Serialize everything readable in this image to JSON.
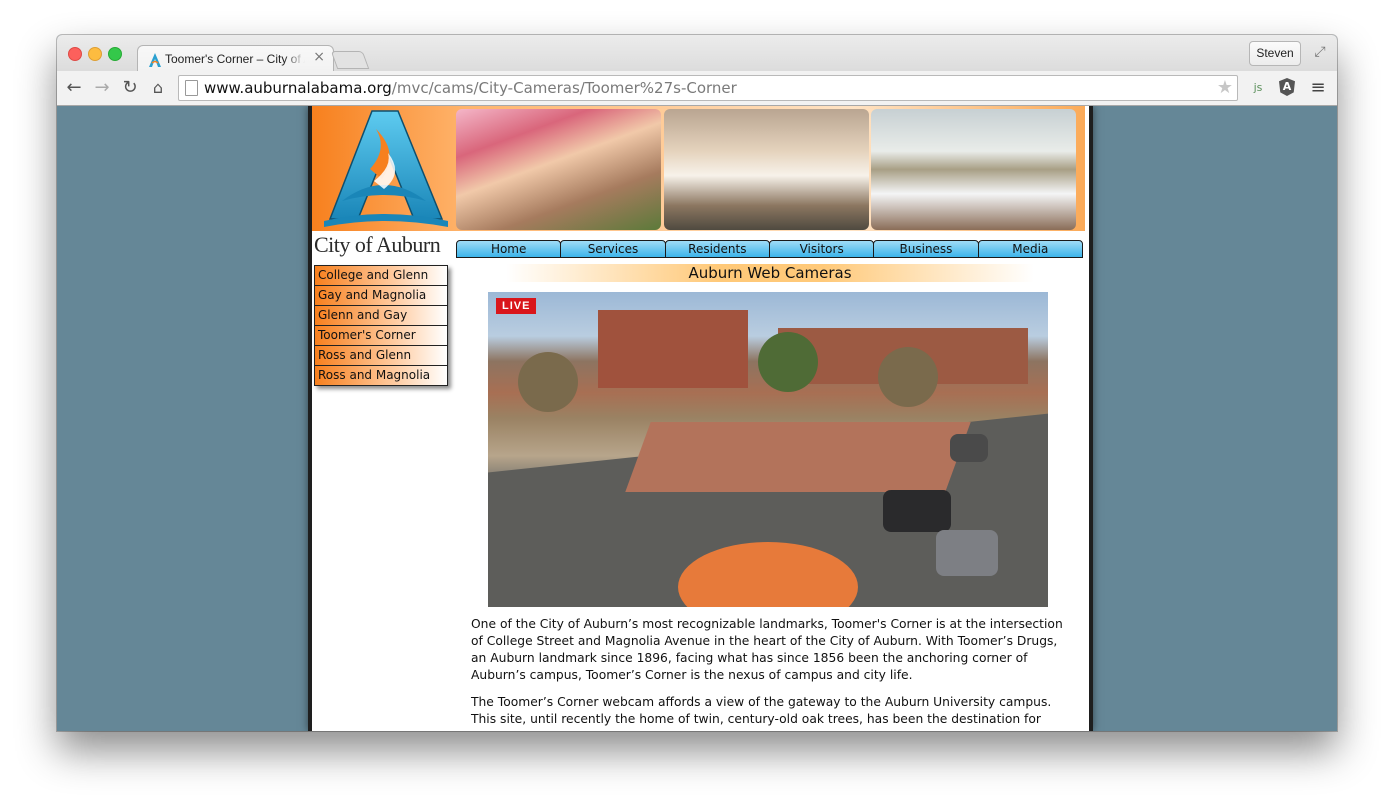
{
  "browser": {
    "tab_title": "Toomer's Corner – City of Auburn",
    "tab_close": "×",
    "profile_name": "Steven",
    "url_host": "www.auburnalabama.org",
    "url_path": "/mvc/cams/City-Cameras/Toomer%27s-Corner",
    "icons": [
      "back-icon",
      "forward-icon",
      "reload-icon",
      "home-icon",
      "page-icon",
      "star-icon",
      "javascript-extension-icon",
      "angular-extension-icon",
      "menu-icon",
      "fullscreen-icon"
    ]
  },
  "site": {
    "logo_text": "City of Auburn",
    "nav": [
      "Home",
      "Services",
      "Residents",
      "Visitors",
      "Business",
      "Media"
    ],
    "sidebar": [
      "College and Glenn",
      "Gay and Magnolia",
      "Glenn and Gay",
      "Toomer's Corner",
      "Ross and Glenn",
      "Ross and Magnolia"
    ],
    "section_title": "Auburn Web Cameras",
    "live_badge": "LIVE",
    "paragraphs": [
      "One of the City of Auburn’s most recognizable landmarks, Toomer's Corner is at the intersection of College Street and Magnolia Avenue in the heart of the City of Auburn. With Toomer’s Drugs, an Auburn landmark since 1896, facing what has since 1856 been the anchoring corner of Auburn’s campus, Toomer’s Corner is the nexus of campus and city life.",
      "The Toomer’s Corner webcam affords a view of the gateway to the Auburn University campus.  This site, until recently the home of twin, century-old oak trees, has been the destination for"
    ]
  },
  "colors": {
    "page_background": "#658797",
    "orange_accent": "#f7801e",
    "nav_blue": "#3cb4ea",
    "live_red": "#d9161b"
  }
}
